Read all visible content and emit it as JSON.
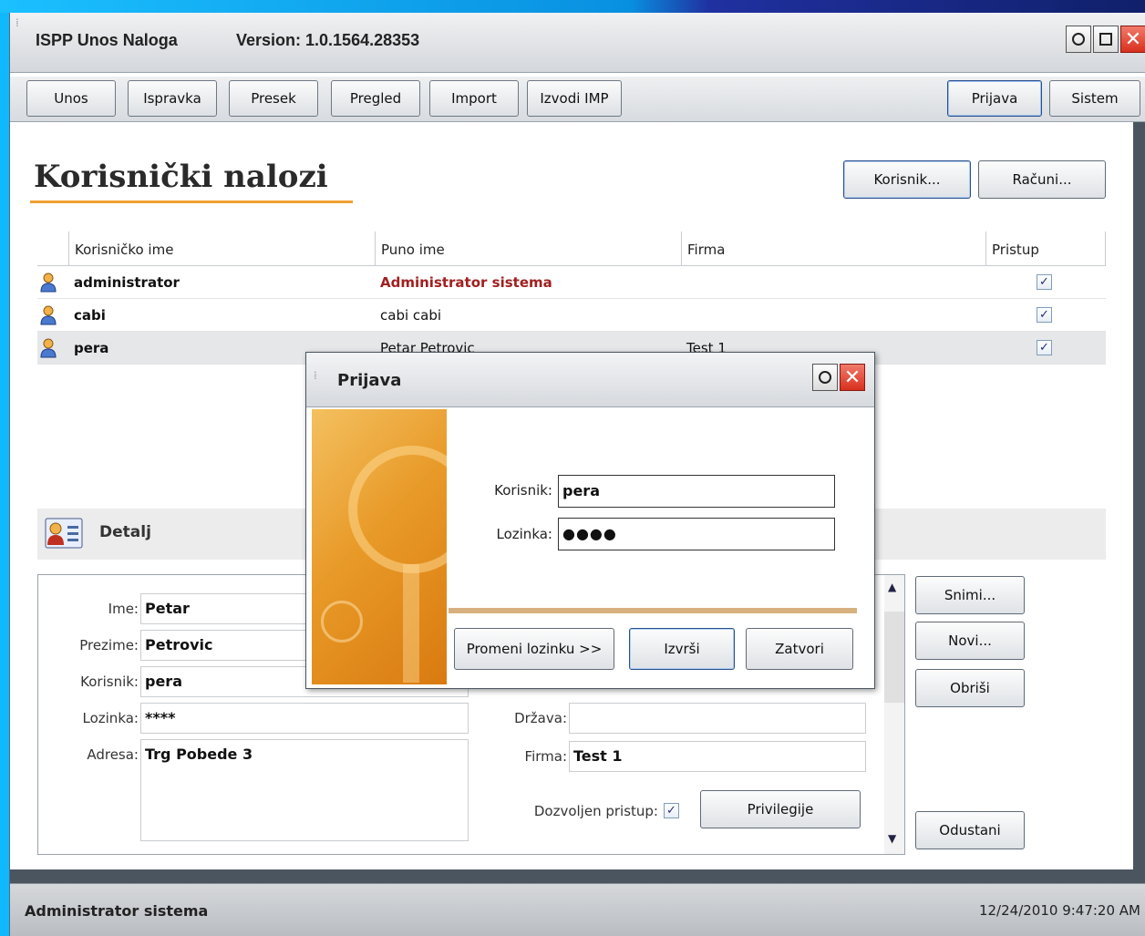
{
  "window": {
    "title": "ISPP Unos Naloga",
    "version": "Version: 1.0.1564.28353"
  },
  "toolbar": {
    "left_buttons": [
      "Unos",
      "Ispravka",
      "Presek",
      "Pregled",
      "Import",
      "Izvodi IMP"
    ],
    "prijava": "Prijava",
    "sistem": "Sistem"
  },
  "page": {
    "title": "Korisnički nalozi",
    "korisnik_button": "Korisnik...",
    "racuni_button": "Računi..."
  },
  "grid": {
    "columns": [
      "Korisničko ime",
      "Puno ime",
      "Firma",
      "Pristup"
    ],
    "rows": [
      {
        "username": "administrator",
        "fullname": "Administrator sistema",
        "firma": "",
        "pristup": true
      },
      {
        "username": "cabi",
        "fullname": "cabi cabi",
        "firma": "",
        "pristup": true
      },
      {
        "username": "pera",
        "fullname": "Petar Petrovic",
        "firma": "Test 1",
        "pristup": true
      }
    ]
  },
  "detail": {
    "title": "Detalj",
    "labels": {
      "ime": "Ime:",
      "prezime": "Prezime:",
      "korisnik": "Korisnik:",
      "lozinka": "Lozinka:",
      "adresa": "Adresa:",
      "drzava": "Država:",
      "firma": "Firma:",
      "dozvoljen": "Dozvoljen pristup:"
    },
    "values": {
      "ime": "Petar",
      "prezime": "Petrovic",
      "korisnik": "pera",
      "lozinka": "****",
      "adresa": "Trg Pobede 3",
      "drzava": "",
      "firma": "Test 1"
    },
    "privilegije": "Privilegije",
    "snimi": "Snimi...",
    "novi": "Novi...",
    "obrisi": "Obriši",
    "odustani": "Odustani"
  },
  "dialog": {
    "title": "Prijava",
    "korisnik_label": "Korisnik:",
    "korisnik_value": "pera",
    "lozinka_label": "Lozinka:",
    "lozinka_value": "●●●●",
    "promeni": "Promeni lozinku >>",
    "izvrsi": "Izvrši",
    "zatvori": "Zatvori"
  },
  "status": {
    "user": "Administrator sistema",
    "datetime": "12/24/2010 9:47:20 AM"
  }
}
